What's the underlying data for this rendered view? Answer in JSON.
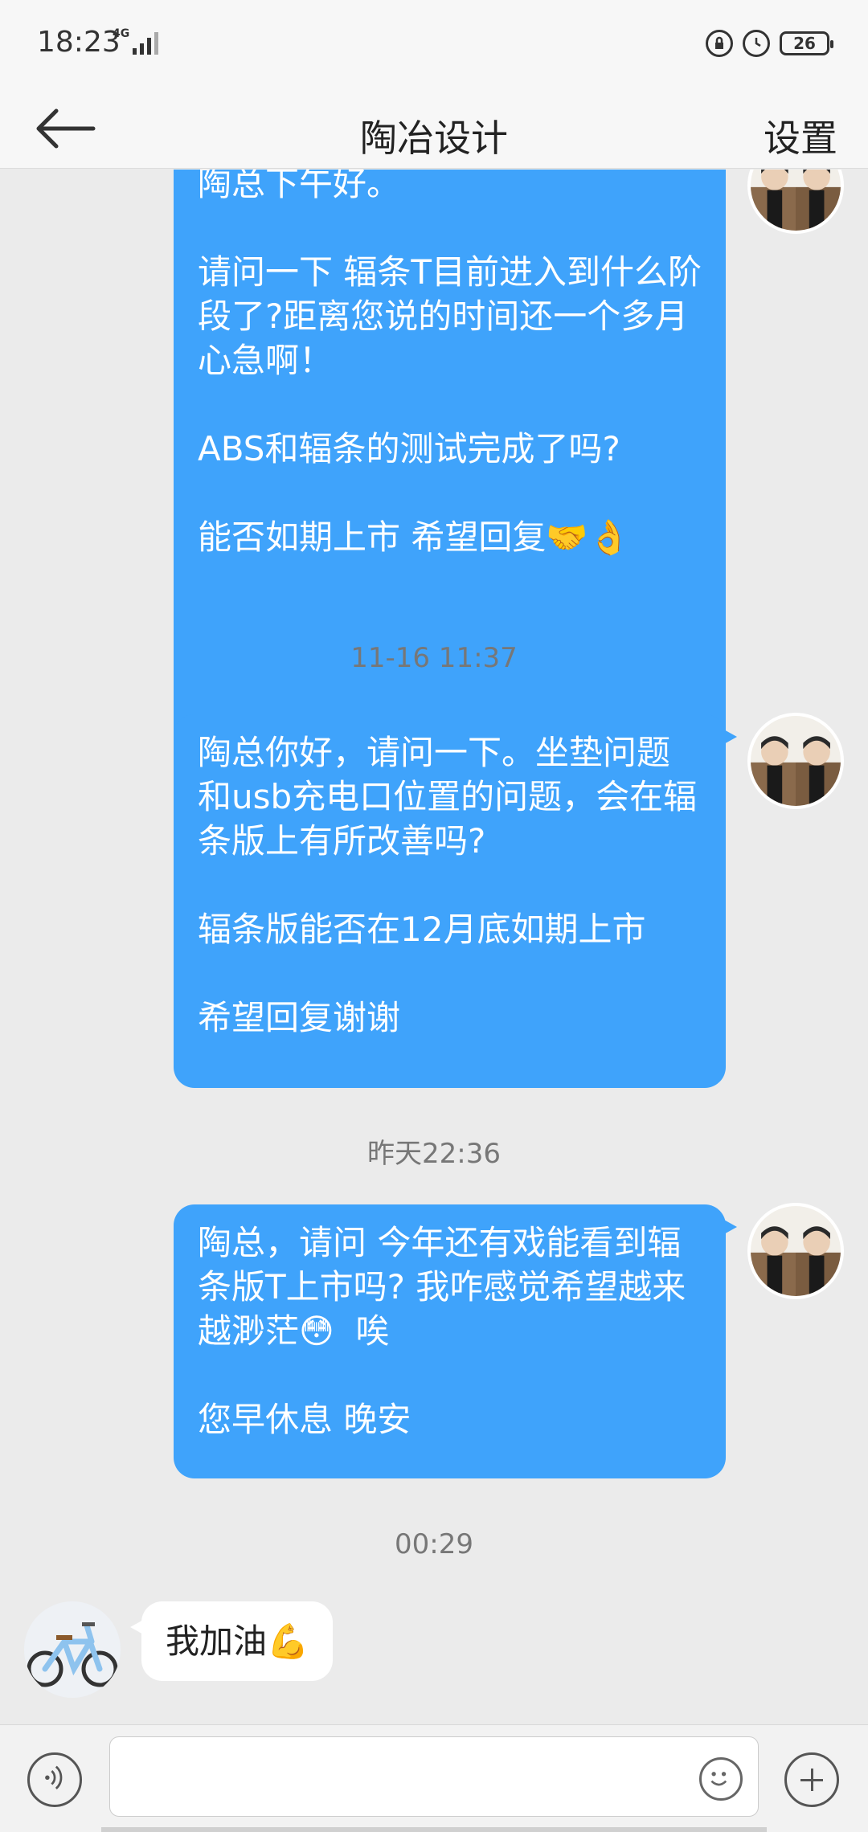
{
  "status_bar": {
    "time": "18:23",
    "network": "4G",
    "battery": "26"
  },
  "header": {
    "title": "陶冶设计",
    "settings_label": "设置"
  },
  "messages": [
    {
      "type": "out",
      "text": "陶总下午好。\n\n请问一下 辐条T目前进入到什么阶段了?距离您说的时间还一个多月 心急啊！\n\nABS和辐条的测试完成了吗?\n\n能否如期上市 希望回复🤝👌"
    },
    {
      "type": "time",
      "text": "11-16 11:37"
    },
    {
      "type": "out",
      "text": "陶总你好，请问一下。坐垫问题和usb充电口位置的问题，会在辐条版上有所改善吗?\n\n辐条版能否在12月底如期上市\n\n希望回复谢谢"
    },
    {
      "type": "time",
      "text": "昨天22:36"
    },
    {
      "type": "out",
      "text": "陶总，请问 今年还有戏能看到辐条版T上市吗? 我咋感觉希望越来越渺茫😳  唉\n\n您早休息 晚安"
    },
    {
      "type": "time",
      "text": "00:29"
    },
    {
      "type": "in",
      "text": "我加油💪"
    }
  ],
  "input": {
    "placeholder": ""
  },
  "icons": {
    "back": "back-arrow-icon",
    "voice": "voice-icon",
    "emoji": "emoji-icon",
    "plus": "plus-icon",
    "lock": "lock-rotation-icon",
    "alarm": "alarm-icon"
  },
  "colors": {
    "bubble_out": "#3fa3fb",
    "bubble_in": "#ffffff",
    "background": "#ebebeb"
  }
}
